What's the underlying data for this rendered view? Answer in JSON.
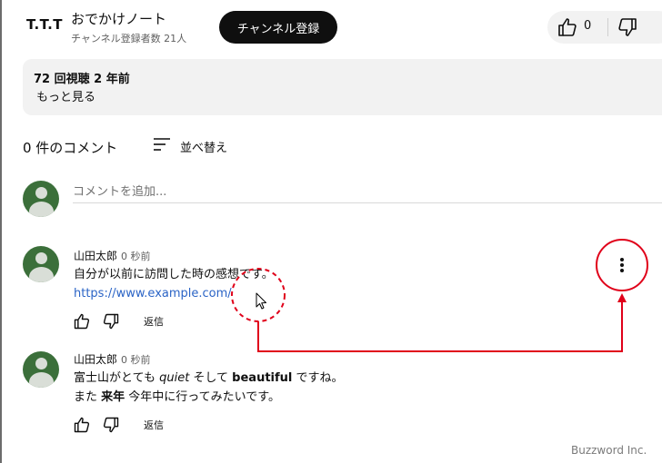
{
  "channel": {
    "logo_text": "T.T.T",
    "name": "おでかけノート",
    "subscribers": "チャンネル登録者数 21人",
    "subscribe_label": "チャンネル登録"
  },
  "video": {
    "like_count": "0",
    "views_age": "72 回視聴 2 年前",
    "more_label": "もっと見る"
  },
  "comments_header": {
    "count_label": "0 件のコメント",
    "sort_label": "並べ替え"
  },
  "add_comment": {
    "placeholder": "コメントを追加..."
  },
  "comments": [
    {
      "author": "山田太郎",
      "time": "0 秒前",
      "text": "自分が以前に訪問した時の感想です。",
      "link": "https://www.example.com/",
      "reply_label": "返信"
    },
    {
      "author": "山田太郎",
      "time": "0 秒前",
      "line1_a": "富士山がとても ",
      "line1_italic": "quiet",
      "line1_b": " そして ",
      "line1_bold": "beautiful",
      "line1_c": " ですね。",
      "line2_a": "また ",
      "line2_bold": "来年",
      "line2_b": " 今年中に行ってみたいです。",
      "reply_label": "返信"
    }
  ],
  "watermark": "Buzzword Inc.",
  "colors": {
    "annotation_red": "#e0001a",
    "link_blue": "#2b64c6",
    "avatar_green": "#3b6f3a"
  }
}
